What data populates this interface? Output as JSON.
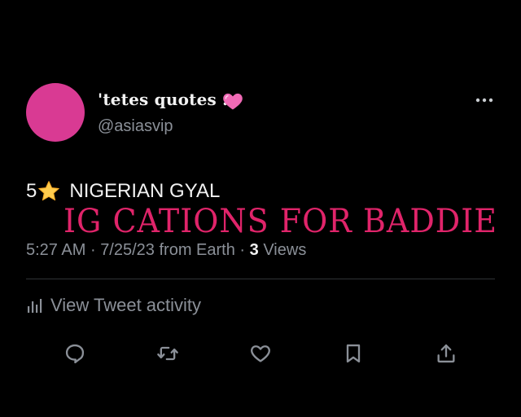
{
  "profile": {
    "display_name": "'tetes quotes .",
    "handle": "@asiasvip",
    "avatar_color": "#d93a93",
    "name_emoji": "pink-heart-icon"
  },
  "tweet": {
    "rating": "5",
    "rating_icon": "star-icon",
    "text": "NIGERIAN GYAL",
    "overlay_title": "IG CATIONS FOR BADDIE",
    "overlay_color": "#e0246a"
  },
  "meta": {
    "time": "5:27 AM",
    "date": "7/25/23",
    "source": "from Earth",
    "views_count": "3",
    "views_label": "Views"
  },
  "activity": {
    "label": "View Tweet activity"
  },
  "actions": [
    "reply-icon",
    "retweet-icon",
    "like-icon",
    "bookmark-icon",
    "share-icon"
  ]
}
